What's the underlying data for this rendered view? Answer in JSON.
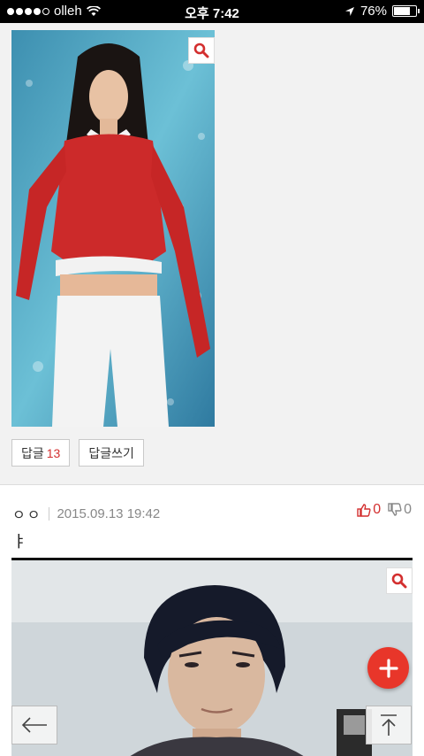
{
  "status_bar": {
    "carrier": "olleh",
    "time": "오후 7:42",
    "battery": "76%",
    "battery_level": 0.76,
    "signal_bars": 4
  },
  "post1": {
    "image_icon": "search-icon",
    "reply_label": "답글",
    "reply_count": "13",
    "write_reply_label": "답글쓰기"
  },
  "post2": {
    "author": "ㅇㅇ",
    "date": "2015.09.13 19:42",
    "upvotes": "0",
    "downvotes": "0",
    "comment": "ㅑ",
    "image_icon": "search-icon"
  },
  "floating": {
    "add_icon": "plus-icon",
    "back_icon": "arrow-left-icon",
    "top_icon": "scroll-top-icon"
  },
  "colors": {
    "accent": "#e8362a",
    "count_red": "#d32f2f"
  }
}
